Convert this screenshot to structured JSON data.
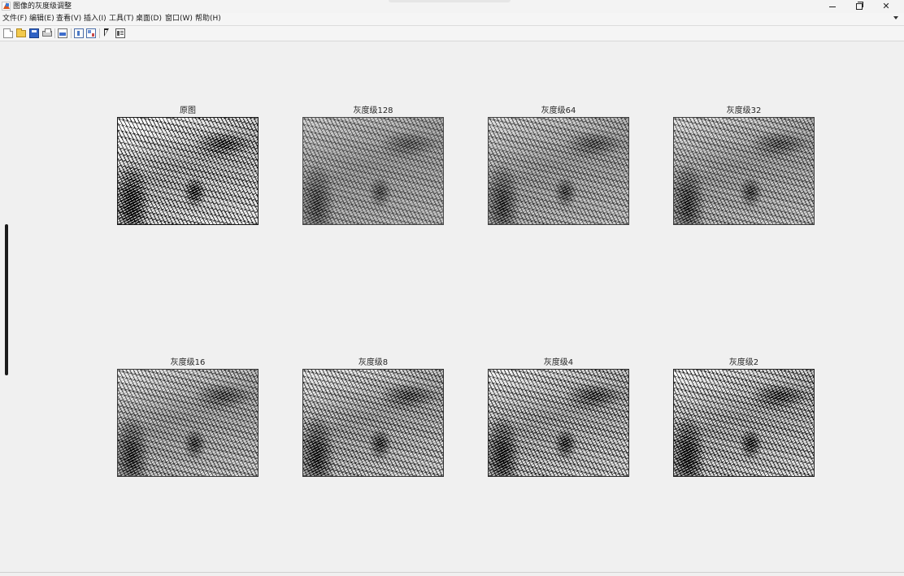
{
  "window": {
    "title": "图像的灰度级调整",
    "controls": {
      "minimize_icon": "minimize-icon",
      "maximize_icon": "restore-icon",
      "close_icon": "close-icon"
    }
  },
  "menubar": {
    "items": [
      "文件(F)",
      "编辑(E)",
      "查看(V)",
      "插入(I)",
      "工具(T)",
      "桌面(D)",
      "窗口(W)",
      "帮助(H)"
    ]
  },
  "toolbar": {
    "icons": [
      "new-figure-icon",
      "open-file-icon",
      "save-icon",
      "print-icon",
      "print-preview-icon",
      "insert-colorbar-icon",
      "insert-legend-icon",
      "edit-plot-pointer-icon",
      "property-inspector-icon"
    ]
  },
  "figure": {
    "subplots": [
      {
        "title": "原图"
      },
      {
        "title": "灰度级128"
      },
      {
        "title": "灰度级64"
      },
      {
        "title": "灰度级32"
      },
      {
        "title": "灰度级16"
      },
      {
        "title": "灰度级8"
      },
      {
        "title": "灰度级4"
      },
      {
        "title": "灰度级2"
      }
    ]
  },
  "colors": {
    "background": "#f0f0f0",
    "axes_border": "#4a4a4a"
  }
}
